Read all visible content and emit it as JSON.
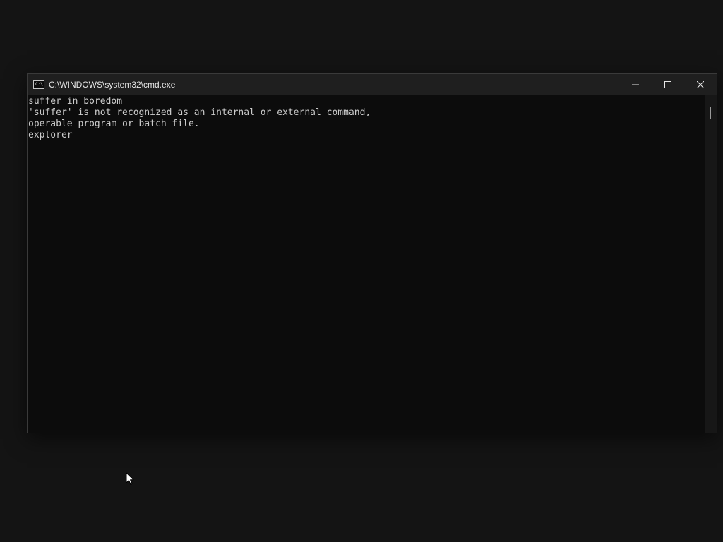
{
  "window": {
    "title": "C:\\WINDOWS\\system32\\cmd.exe",
    "icon": "cmd-icon",
    "icon_text": "C:\\",
    "controls": {
      "minimize": "minimize-icon",
      "maximize": "maximize-icon",
      "close": "close-icon"
    }
  },
  "console": {
    "lines": [
      "suffer in boredom",
      "'suffer' is not recognized as an internal or external command,",
      "operable program or batch file.",
      "explorer"
    ],
    "text_color": "#cccccc",
    "background": "#0c0c0c"
  },
  "desktop": {
    "background": "#141414",
    "pointer": "mouse-pointer-icon"
  }
}
